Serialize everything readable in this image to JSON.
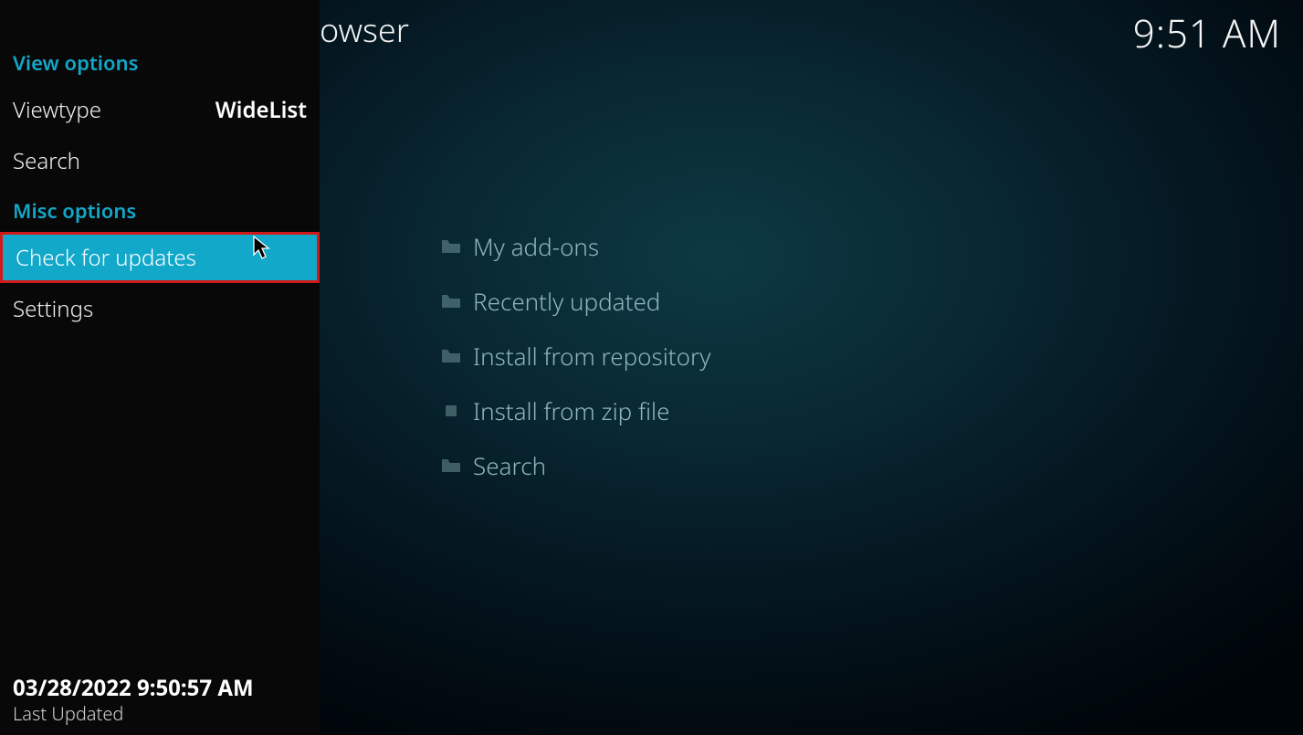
{
  "header": {
    "title_tail": "owser",
    "clock": "9:51 AM"
  },
  "sidebar": {
    "view_options_hdr": "View options",
    "viewtype_label": "Viewtype",
    "viewtype_value": "WideList",
    "search_label": "Search",
    "misc_options_hdr": "Misc options",
    "check_updates_label": "Check for updates",
    "settings_label": "Settings",
    "footer_timestamp": "03/28/2022 9:50:57 AM",
    "footer_caption": "Last Updated"
  },
  "main": {
    "items": [
      {
        "icon": "folder",
        "label": "My add-ons"
      },
      {
        "icon": "folder",
        "label": "Recently updated"
      },
      {
        "icon": "folder",
        "label": "Install from repository"
      },
      {
        "icon": "zip",
        "label": "Install from zip file"
      },
      {
        "icon": "folder",
        "label": "Search"
      }
    ]
  }
}
